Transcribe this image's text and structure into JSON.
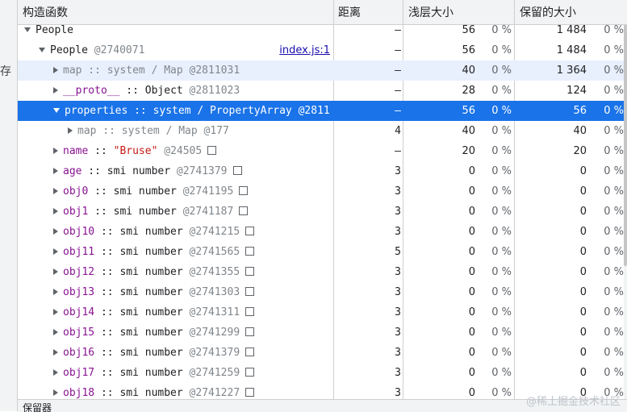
{
  "sidebar": {
    "label": "存"
  },
  "columns": {
    "constructor": "构造函数",
    "distance": "距离",
    "shallow": "浅层大小",
    "retained": "保留的大小"
  },
  "rows": [
    {
      "indent": 0,
      "expander": "down",
      "segments": [
        {
          "t": "People",
          "c": "plain"
        }
      ],
      "distance": "–",
      "shallow": "56",
      "shallow_pct": "0 %",
      "retained": "1 484",
      "retained_pct": "0 %",
      "state": ""
    },
    {
      "indent": 1,
      "expander": "down",
      "segments": [
        {
          "t": "People",
          "c": "plain"
        },
        {
          "t": " @2740071",
          "c": "dim"
        }
      ],
      "link": "index.js:1",
      "distance": "–",
      "shallow": "56",
      "shallow_pct": "0 %",
      "retained": "1 484",
      "retained_pct": "0 %",
      "state": ""
    },
    {
      "indent": 2,
      "expander": "right",
      "segments": [
        {
          "t": "map :: system / Map @2811031",
          "c": "dim"
        }
      ],
      "distance": "–",
      "shallow": "40",
      "shallow_pct": "0 %",
      "retained": "1 364",
      "retained_pct": "0 %",
      "state": "highlight"
    },
    {
      "indent": 2,
      "expander": "right",
      "segments": [
        {
          "t": "__proto__",
          "c": "prop"
        },
        {
          "t": " :: Object",
          "c": "plain"
        },
        {
          "t": " @2811023",
          "c": "dim"
        }
      ],
      "distance": "–",
      "shallow": "28",
      "shallow_pct": "0 %",
      "retained": "124",
      "retained_pct": "0 %",
      "state": ""
    },
    {
      "indent": 2,
      "expander": "down",
      "segments": [
        {
          "t": "properties :: system / PropertyArray @2811",
          "c": "plain"
        }
      ],
      "distance": "–",
      "shallow": "56",
      "shallow_pct": "0 %",
      "retained": "56",
      "retained_pct": "0 %",
      "state": "selected"
    },
    {
      "indent": 3,
      "expander": "right",
      "segments": [
        {
          "t": "map :: system / Map @177",
          "c": "dim"
        }
      ],
      "distance": "4",
      "shallow": "40",
      "shallow_pct": "0 %",
      "retained": "40",
      "retained_pct": "0 %",
      "state": ""
    },
    {
      "indent": 2,
      "expander": "right",
      "segments": [
        {
          "t": "name",
          "c": "prop"
        },
        {
          "t": " :: ",
          "c": "plain"
        },
        {
          "t": "\"Bruse\"",
          "c": "str"
        },
        {
          "t": " @24505",
          "c": "dim"
        }
      ],
      "box": true,
      "distance": "–",
      "shallow": "20",
      "shallow_pct": "0 %",
      "retained": "20",
      "retained_pct": "0 %",
      "state": ""
    },
    {
      "indent": 2,
      "expander": "right",
      "segments": [
        {
          "t": "age",
          "c": "prop"
        },
        {
          "t": " :: smi number",
          "c": "plain"
        },
        {
          "t": " @2741379",
          "c": "dim"
        }
      ],
      "box": true,
      "distance": "3",
      "shallow": "0",
      "shallow_pct": "0 %",
      "retained": "0",
      "retained_pct": "0 %",
      "state": ""
    },
    {
      "indent": 2,
      "expander": "right",
      "segments": [
        {
          "t": "obj0",
          "c": "prop"
        },
        {
          "t": " :: smi number",
          "c": "plain"
        },
        {
          "t": " @2741195",
          "c": "dim"
        }
      ],
      "box": true,
      "distance": "3",
      "shallow": "0",
      "shallow_pct": "0 %",
      "retained": "0",
      "retained_pct": "0 %",
      "state": ""
    },
    {
      "indent": 2,
      "expander": "right",
      "segments": [
        {
          "t": "obj1",
          "c": "prop"
        },
        {
          "t": " :: smi number",
          "c": "plain"
        },
        {
          "t": " @2741187",
          "c": "dim"
        }
      ],
      "box": true,
      "distance": "3",
      "shallow": "0",
      "shallow_pct": "0 %",
      "retained": "0",
      "retained_pct": "0 %",
      "state": ""
    },
    {
      "indent": 2,
      "expander": "right",
      "segments": [
        {
          "t": "obj10",
          "c": "prop"
        },
        {
          "t": " :: smi number",
          "c": "plain"
        },
        {
          "t": " @2741215",
          "c": "dim"
        }
      ],
      "box": true,
      "distance": "3",
      "shallow": "0",
      "shallow_pct": "0 %",
      "retained": "0",
      "retained_pct": "0 %",
      "state": ""
    },
    {
      "indent": 2,
      "expander": "right",
      "segments": [
        {
          "t": "obj11",
          "c": "prop"
        },
        {
          "t": " :: smi number",
          "c": "plain"
        },
        {
          "t": " @2741565",
          "c": "dim"
        }
      ],
      "box": true,
      "distance": "5",
      "shallow": "0",
      "shallow_pct": "0 %",
      "retained": "0",
      "retained_pct": "0 %",
      "state": ""
    },
    {
      "indent": 2,
      "expander": "right",
      "segments": [
        {
          "t": "obj12",
          "c": "prop"
        },
        {
          "t": " :: smi number",
          "c": "plain"
        },
        {
          "t": " @2741355",
          "c": "dim"
        }
      ],
      "box": true,
      "distance": "3",
      "shallow": "0",
      "shallow_pct": "0 %",
      "retained": "0",
      "retained_pct": "0 %",
      "state": ""
    },
    {
      "indent": 2,
      "expander": "right",
      "segments": [
        {
          "t": "obj13",
          "c": "prop"
        },
        {
          "t": " :: smi number",
          "c": "plain"
        },
        {
          "t": " @2741303",
          "c": "dim"
        }
      ],
      "box": true,
      "distance": "3",
      "shallow": "0",
      "shallow_pct": "0 %",
      "retained": "0",
      "retained_pct": "0 %",
      "state": ""
    },
    {
      "indent": 2,
      "expander": "right",
      "segments": [
        {
          "t": "obj14",
          "c": "prop"
        },
        {
          "t": " :: smi number",
          "c": "plain"
        },
        {
          "t": " @2741311",
          "c": "dim"
        }
      ],
      "box": true,
      "distance": "3",
      "shallow": "0",
      "shallow_pct": "0 %",
      "retained": "0",
      "retained_pct": "0 %",
      "state": ""
    },
    {
      "indent": 2,
      "expander": "right",
      "segments": [
        {
          "t": "obj15",
          "c": "prop"
        },
        {
          "t": " :: smi number",
          "c": "plain"
        },
        {
          "t": " @2741299",
          "c": "dim"
        }
      ],
      "box": true,
      "distance": "3",
      "shallow": "0",
      "shallow_pct": "0 %",
      "retained": "0",
      "retained_pct": "0 %",
      "state": ""
    },
    {
      "indent": 2,
      "expander": "right",
      "segments": [
        {
          "t": "obj16",
          "c": "prop"
        },
        {
          "t": " :: smi number",
          "c": "plain"
        },
        {
          "t": " @2741379",
          "c": "dim"
        }
      ],
      "box": true,
      "distance": "3",
      "shallow": "0",
      "shallow_pct": "0 %",
      "retained": "0",
      "retained_pct": "0 %",
      "state": ""
    },
    {
      "indent": 2,
      "expander": "right",
      "segments": [
        {
          "t": "obj17",
          "c": "prop"
        },
        {
          "t": " :: smi number",
          "c": "plain"
        },
        {
          "t": " @2741259",
          "c": "dim"
        }
      ],
      "box": true,
      "distance": "3",
      "shallow": "0",
      "shallow_pct": "0 %",
      "retained": "0",
      "retained_pct": "0 %",
      "state": ""
    },
    {
      "indent": 2,
      "expander": "right",
      "segments": [
        {
          "t": "obj18",
          "c": "prop"
        },
        {
          "t": " :: smi number",
          "c": "plain"
        },
        {
          "t": " @2741227",
          "c": "dim"
        }
      ],
      "box": true,
      "distance": "3",
      "shallow": "0",
      "shallow_pct": "0 %",
      "retained": "0",
      "retained_pct": "0 %",
      "state": ""
    }
  ],
  "footer": {
    "label": "保留器"
  },
  "watermark": "@稀土掘金技术社区",
  "colors": {
    "selected": "#1a73e8",
    "highlight": "#e8f0fe",
    "property": "#881391",
    "string": "#c41a16"
  }
}
